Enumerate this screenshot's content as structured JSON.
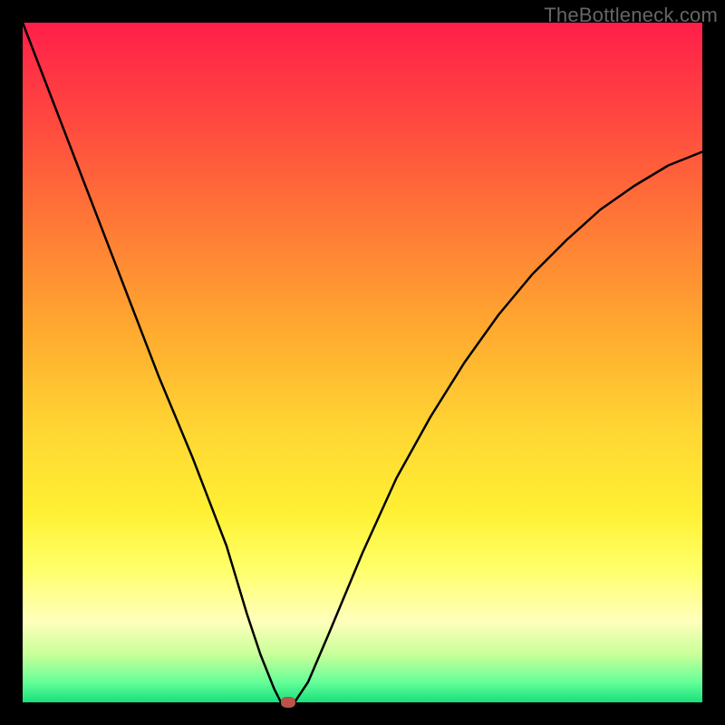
{
  "watermark": "TheBottleneck.com",
  "chart_data": {
    "type": "line",
    "title": "",
    "xlabel": "",
    "ylabel": "",
    "xlim": [
      0,
      100
    ],
    "ylim": [
      0,
      100
    ],
    "background_gradient": [
      "#ff1f4a",
      "#ff7a36",
      "#ffd633",
      "#ffff66",
      "#18e07a"
    ],
    "series": [
      {
        "name": "bottleneck-curve",
        "x": [
          0,
          5,
          10,
          15,
          20,
          25,
          30,
          33,
          35,
          37,
          38,
          39,
          40,
          42,
          45,
          50,
          55,
          60,
          65,
          70,
          75,
          80,
          85,
          90,
          95,
          100
        ],
        "values": [
          100,
          87,
          74,
          61,
          48,
          36,
          23,
          13,
          7,
          2,
          0,
          0,
          0,
          3,
          10,
          22,
          33,
          42,
          50,
          57,
          63,
          68,
          72.5,
          76,
          79,
          81
        ]
      }
    ],
    "marker": {
      "x": 39,
      "y": 0,
      "color": "#b85448"
    },
    "grid": false,
    "legend": false
  }
}
